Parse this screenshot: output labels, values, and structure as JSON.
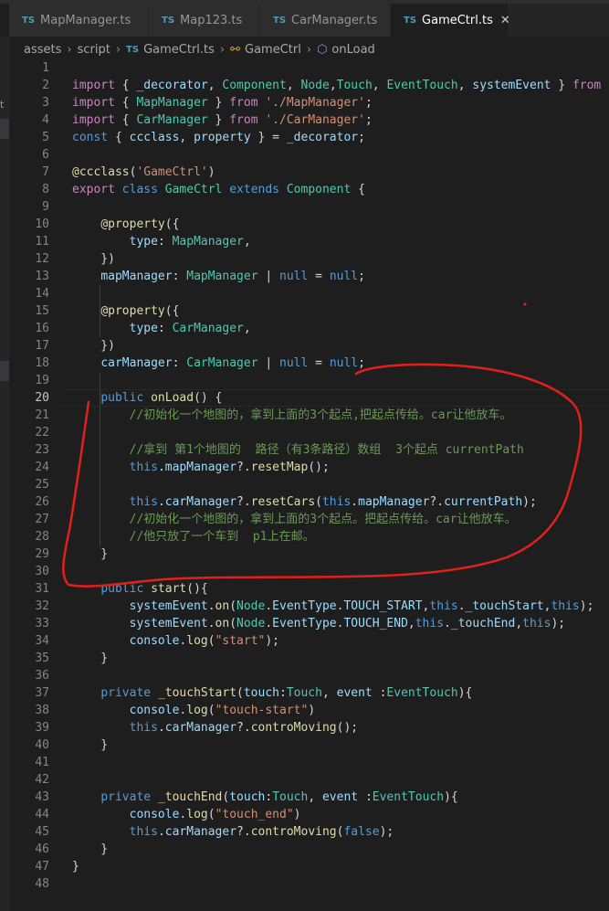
{
  "tabs": [
    {
      "icon": "TS",
      "label": "MapManager.ts",
      "active": false
    },
    {
      "icon": "TS",
      "label": "Map123.ts",
      "active": false
    },
    {
      "icon": "TS",
      "label": "CarManager.ts",
      "active": false
    },
    {
      "icon": "TS",
      "label": "GameCtrl.ts",
      "active": true,
      "close": "✕"
    }
  ],
  "left_strip": {
    "stub": "t"
  },
  "breadcrumb": {
    "assets": "assets",
    "script": "script",
    "file_icon": "TS",
    "file": "GameCtrl.ts",
    "class_icon": "class-icon",
    "class": "GameCtrl",
    "method_icon": "method-icon",
    "method": "onLoad"
  },
  "editor": {
    "current_line": 20,
    "lines": [
      "",
      "import { _decorator, Component, Node,Touch, EventTouch, systemEvent } from 'c",
      "import { MapManager } from './MapManager';",
      "import { CarManager } from './CarManager';",
      "const { ccclass, property } = _decorator;",
      "",
      "@ccclass('GameCtrl')",
      "export class GameCtrl extends Component {",
      "",
      "    @property({",
      "        type: MapManager,",
      "    })",
      "    mapManager: MapManager | null = null;",
      "",
      "    @property({",
      "        type: CarManager,",
      "    })",
      "    carManager: CarManager | null = null;",
      "",
      "    public onLoad() {",
      "        //初始化一个地图的，拿到上面的3个起点,把起点传给。car让他放车。",
      "",
      "        //拿到 第1个地图的  路径（有3条路径）数组  3个起点 currentPath",
      "        this.mapManager?.resetMap();",
      "",
      "        this.carManager?.resetCars(this.mapManager?.currentPath);",
      "        //初始化一个地图的，拿到上面的3个起点。把起点传给。car让他放车。",
      "        //他只放了一个车到  p1上在邮。",
      "    }",
      "",
      "    public start(){",
      "        systemEvent.on(Node.EventType.TOUCH_START,this._touchStart,this);",
      "        systemEvent.on(Node.EventType.TOUCH_END,this._touchEnd,this);",
      "        console.log(\"start\");",
      "    }",
      "",
      "    private _touchStart(touch:Touch, event :EventTouch){",
      "        console.log(\"touch-start\")",
      "        this.carManager?.controMoving();",
      "    }",
      "",
      "",
      "    private _touchEnd(touch:Touch, event :EventTouch){",
      "        console.log(\"touch_end\")",
      "        this.carManager?.controMoving(false);",
      "    }",
      "}",
      ""
    ]
  },
  "annotation": {
    "color": "#e0201b"
  }
}
